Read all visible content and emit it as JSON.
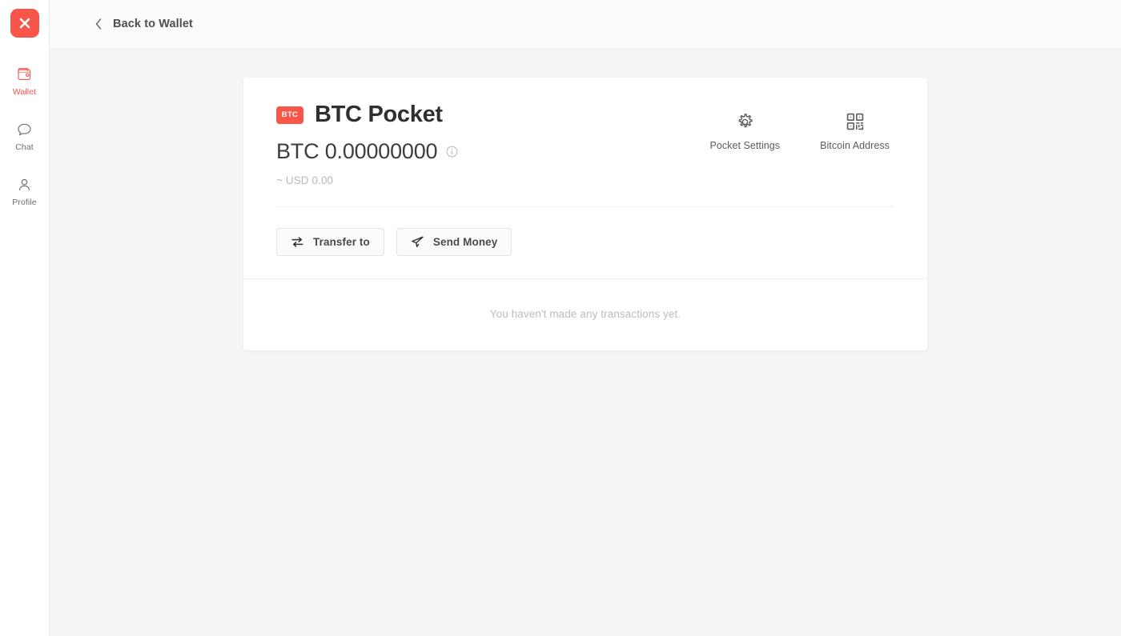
{
  "sidebar": {
    "logo": {
      "icon": "x-logo-icon",
      "glyph": "X",
      "color": "#f8554b"
    },
    "items": [
      {
        "label": "Wallet",
        "icon": "wallet-icon",
        "active": true
      },
      {
        "label": "Chat",
        "icon": "chat-bubble-icon",
        "active": false
      },
      {
        "label": "Profile",
        "icon": "user-icon",
        "active": false
      }
    ]
  },
  "topbar": {
    "back_label": "Back to Wallet",
    "back_icon": "chevron-left-icon"
  },
  "pocket": {
    "coin_badge": "BTC",
    "title": "BTC Pocket",
    "balance": "BTC 0.00000000",
    "balance_info_icon": "info-circle-icon",
    "balance_sub": "~ USD 0.00",
    "accent_color": "#f8554b"
  },
  "header_actions": [
    {
      "label": "Pocket Settings",
      "icon": "gear-icon"
    },
    {
      "label": "Bitcoin Address",
      "icon": "qr-code-icon"
    }
  ],
  "buttons": [
    {
      "label": "Transfer to",
      "icon": "transfer-arrows-icon"
    },
    {
      "label": "Send Money",
      "icon": "paper-plane-icon"
    }
  ],
  "transactions": {
    "empty_message": "You haven't made any transactions yet."
  }
}
